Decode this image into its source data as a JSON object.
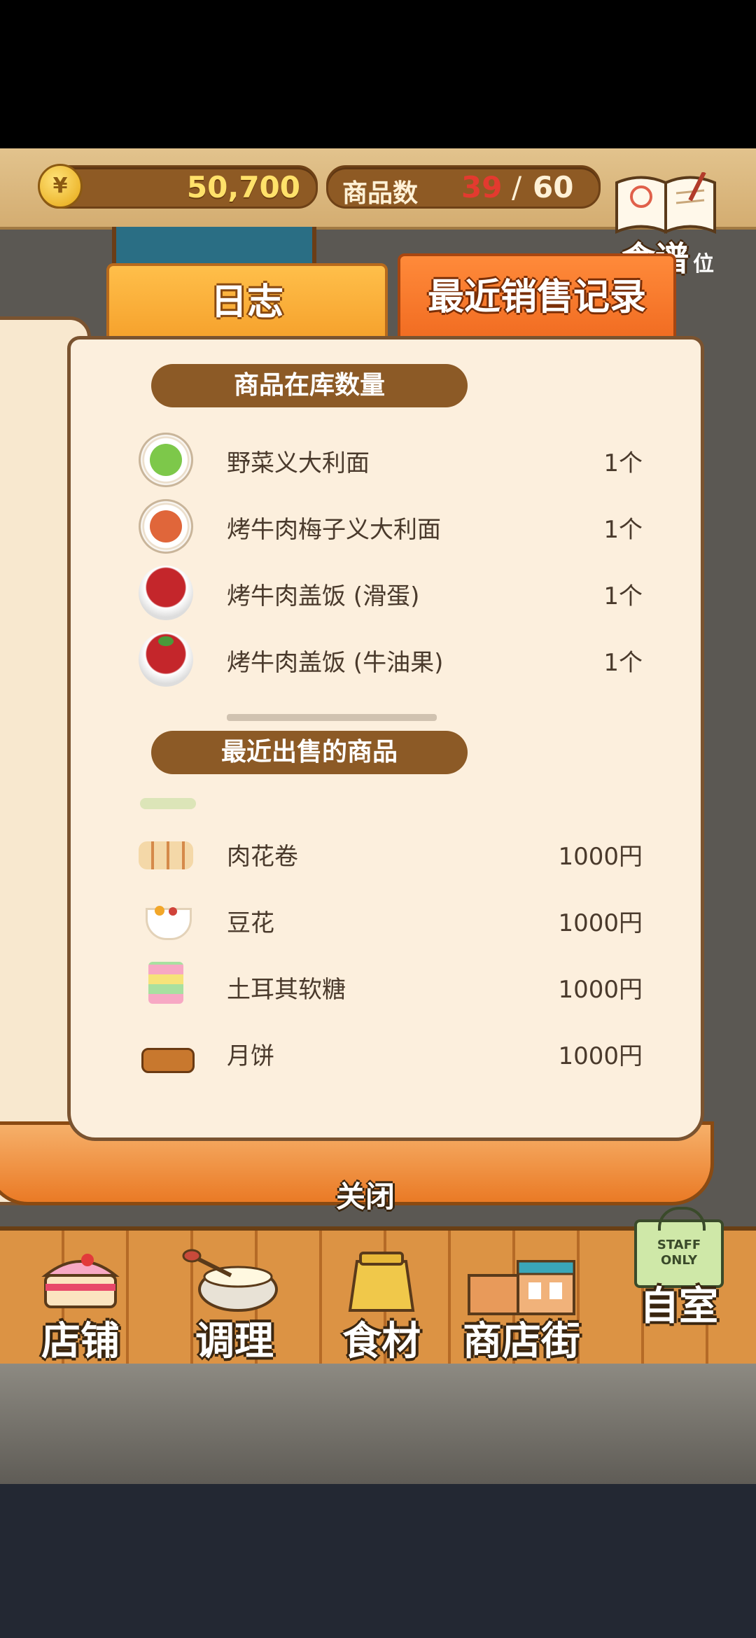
{
  "header": {
    "currency_symbol": "¥",
    "money": "50,700",
    "item_count_label": "商品数",
    "item_count_current": "39",
    "item_count_separator": "/",
    "item_count_max": "60",
    "recipe_label": "食谱",
    "rank_partial": "位"
  },
  "tabs": [
    {
      "label": "日志"
    },
    {
      "label": "最近销售记录"
    }
  ],
  "stock_section": {
    "title": "商品在库数量",
    "items": [
      {
        "name": "野菜义大利面",
        "value": "1个"
      },
      {
        "name": "烤牛肉梅子义大利面",
        "value": "1个"
      },
      {
        "name": "烤牛肉盖饭 (滑蛋)",
        "value": "1个"
      },
      {
        "name": "烤牛肉盖饭 (牛油果)",
        "value": "1个"
      }
    ]
  },
  "sold_section": {
    "title": "最近出售的商品",
    "items": [
      {
        "name": "肉花卷",
        "value": "1000円"
      },
      {
        "name": "豆花",
        "value": "1000円"
      },
      {
        "name": "土耳其软糖",
        "value": "1000円"
      },
      {
        "name": "月饼",
        "value": "1000円"
      }
    ]
  },
  "close_label": "关闭",
  "nav": [
    {
      "label": "店铺"
    },
    {
      "label": "调理"
    },
    {
      "label": "食材"
    },
    {
      "label": "商店街"
    },
    {
      "label": "自室",
      "sign": "STAFF ONLY"
    }
  ]
}
